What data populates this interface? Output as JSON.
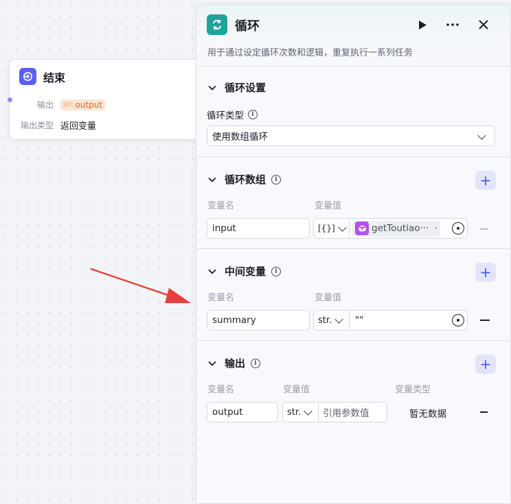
{
  "end_node": {
    "title": "结束",
    "output_label": "输出",
    "output_type_tag": "str.",
    "output_value": "output",
    "output_type_label": "输出类型",
    "output_type_value": "返回变量"
  },
  "panel": {
    "title": "循环",
    "description": "用于通过设定循环次数和逻辑，重复执行一系列任务",
    "loop_settings": {
      "title": "循环设置",
      "type_label": "循环类型",
      "type_value": "使用数组循环"
    },
    "loop_array": {
      "title": "循环数组",
      "col_name": "变量名",
      "col_value": "变量值",
      "row": {
        "name": "input",
        "type": "[{}]",
        "ref": "getToutiao···"
      }
    },
    "intermediate": {
      "title": "中间变量",
      "col_name": "变量名",
      "col_value": "变量值",
      "row": {
        "name": "summary",
        "type": "str.",
        "value": "\"\""
      }
    },
    "output": {
      "title": "输出",
      "col_name": "变量名",
      "col_value": "变量值",
      "col_type": "变量类型",
      "row": {
        "name": "output",
        "type": "str.",
        "placeholder": "引用参数值",
        "var_type": "暂无数据"
      }
    }
  },
  "colors": {
    "accent": "#4d53e8",
    "loop_icon": "#1fa39a",
    "end_icon": "#5b5ef0",
    "arrow": "#e8403a"
  },
  "icons": [
    "end-node-icon",
    "loop-icon",
    "play-icon",
    "more-icon",
    "close-icon",
    "collapse-chevron-icon",
    "info-icon",
    "plus-icon",
    "minus-icon",
    "cube-icon",
    "variable-picker-icon"
  ]
}
